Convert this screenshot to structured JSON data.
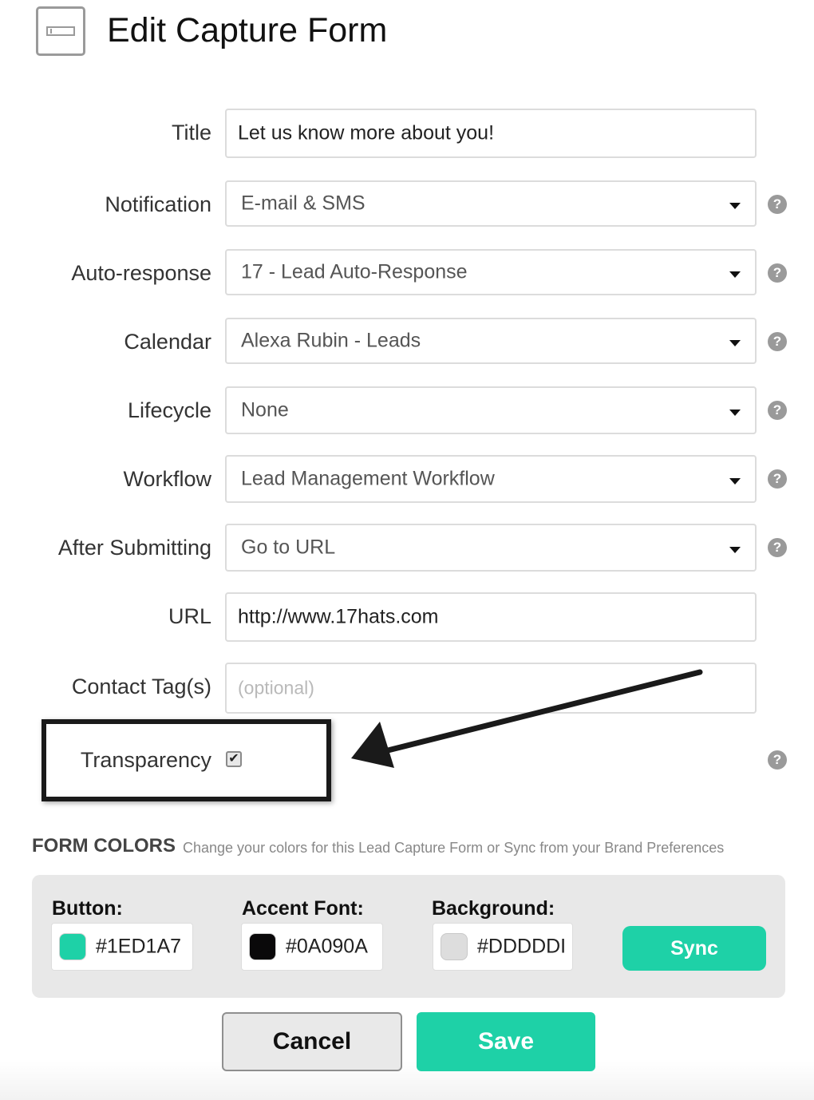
{
  "header": {
    "title": "Edit Capture Form",
    "icon": "form-icon"
  },
  "fields": {
    "title": {
      "label": "Title",
      "value": "Let us know more about you!"
    },
    "notification": {
      "label": "Notification",
      "value": "E-mail & SMS"
    },
    "auto_response": {
      "label": "Auto-response",
      "value": "17 - Lead Auto-Response"
    },
    "calendar": {
      "label": "Calendar",
      "value": "Alexa Rubin - Leads"
    },
    "lifecycle": {
      "label": "Lifecycle",
      "value": "None"
    },
    "workflow": {
      "label": "Workflow",
      "value": "Lead Management Workflow"
    },
    "after_submitting": {
      "label": "After Submitting",
      "value": "Go to URL"
    },
    "url": {
      "label": "URL",
      "value": "http://www.17hats.com"
    },
    "contact_tags": {
      "label": "Contact Tag(s)",
      "value": "",
      "placeholder": "(optional)"
    },
    "transparency": {
      "label": "Transparency",
      "checked": true,
      "check_glyph": "✔"
    }
  },
  "help_glyph": "?",
  "form_colors": {
    "title": "FORM COLORS",
    "subtitle": "Change your colors for this Lead Capture Form or Sync from your Brand Preferences",
    "button": {
      "label": "Button:",
      "value": "#1ED1A7",
      "swatch": "#1ED1A7"
    },
    "accent_font": {
      "label": "Accent Font:",
      "value": "#0A090A",
      "swatch": "#0A090A"
    },
    "background": {
      "label": "Background:",
      "value": "#DDDDDI",
      "swatch": "#DDDDDD"
    },
    "sync_label": "Sync"
  },
  "actions": {
    "cancel_label": "Cancel",
    "save_label": "Save"
  },
  "colors": {
    "accent": "#1ED1A7",
    "panel": "#E8E8E8",
    "help_icon": "#9A9A9A"
  }
}
